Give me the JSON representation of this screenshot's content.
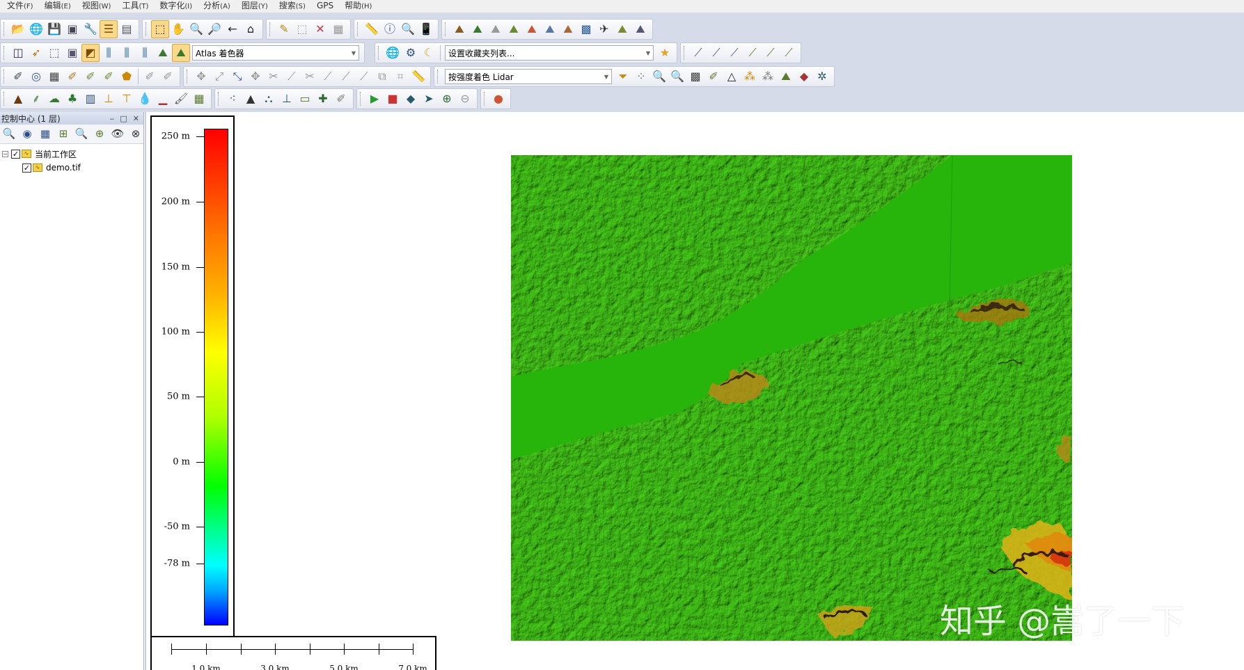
{
  "menu": [
    {
      "label": "文件",
      "key": "(F)"
    },
    {
      "label": "编辑",
      "key": "(E)"
    },
    {
      "label": "视图",
      "key": "(W)"
    },
    {
      "label": "工具",
      "key": "(T)"
    },
    {
      "label": "数字化",
      "key": "(I)"
    },
    {
      "label": "分析",
      "key": "(A)"
    },
    {
      "label": "图层",
      "key": "(Y)"
    },
    {
      "label": "搜索",
      "key": "(S)"
    },
    {
      "label": "GPS",
      "key": ""
    },
    {
      "label": "帮助",
      "key": "(H)"
    }
  ],
  "toolbar": {
    "shader_combo": "Atlas 着色器",
    "favorites_combo": "设置收藏夹列表...",
    "lidar_combo": "按强度着色 Lidar"
  },
  "panel": {
    "title": "控制中心 (1 层)",
    "workspace": "当前工作区",
    "layer": "demo.tif"
  },
  "legend": {
    "labels": [
      "250 m",
      "200 m",
      "150 m",
      "100 m",
      "50 m",
      "0 m",
      "-50 m",
      "-78 m"
    ],
    "colors": [
      "#ff0000",
      "#ff7a00",
      "#ffb000",
      "#ffff00",
      "#b0ff00",
      "#00ff00",
      "#00ffff",
      "#0000ff"
    ]
  },
  "scalebar": {
    "labels": [
      "1.0 km",
      "3.0 km",
      "5.0 km",
      "7.0 km"
    ]
  },
  "watermark": "知乎 @嵩了一下"
}
